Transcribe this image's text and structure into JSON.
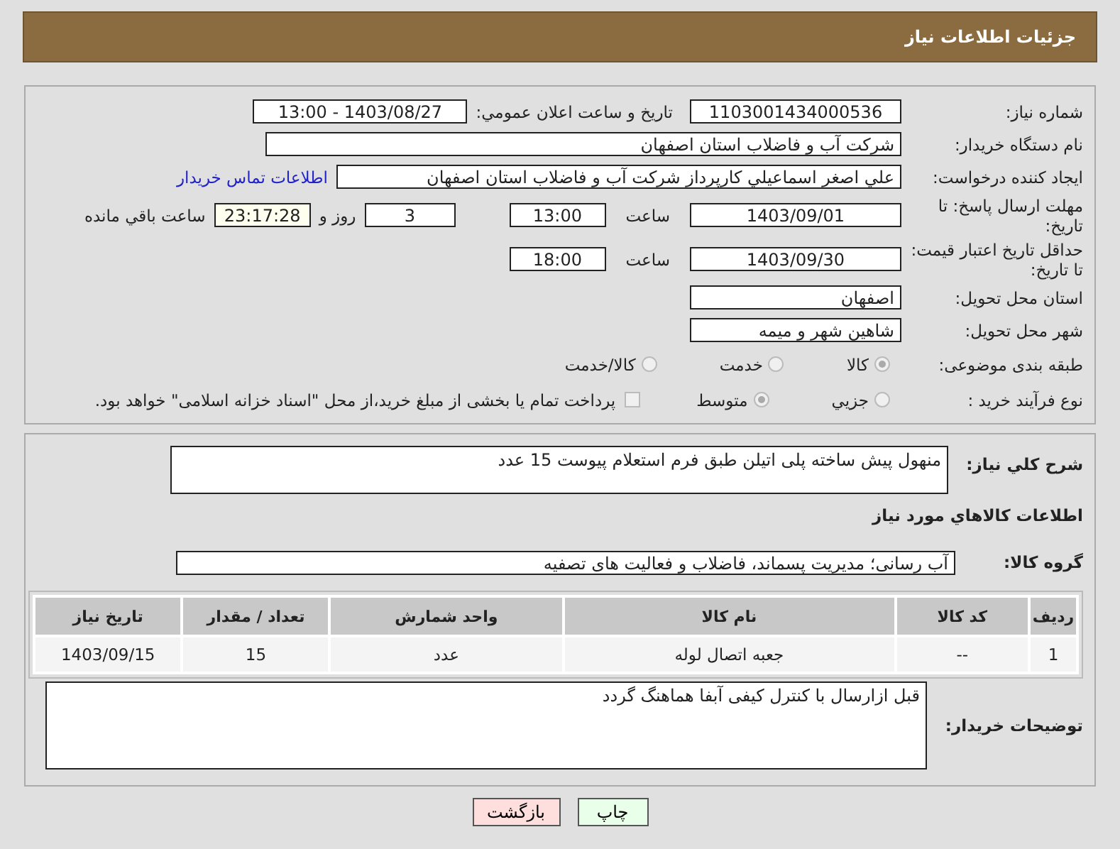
{
  "header": {
    "title": "جزئیات اطلاعات نیاز"
  },
  "need_number": {
    "label": "شماره نیاز:",
    "value": "1103001434000536"
  },
  "announce": {
    "label": "تاریخ و ساعت اعلان عمومي:",
    "value": "1403/08/27 - 13:00"
  },
  "buyer_org": {
    "label": "نام دستگاه خریدار:",
    "value": "شرکت آب و فاضلاب استان اصفهان"
  },
  "requester": {
    "label": "ایجاد کننده درخواست:",
    "value": "علي اصغر اسماعيلي کارپرداز شرکت آب و فاضلاب استان اصفهان",
    "link": "اطلاعات تماس خریدار"
  },
  "reply_deadline": {
    "label": "مهلت ارسال پاسخ: تا تاریخ:",
    "date": "1403/09/01",
    "time_label": "ساعت",
    "time": "13:00",
    "days": "3",
    "days_label": "روز و",
    "remaining": "23:17:28",
    "remaining_label": "ساعت باقي مانده"
  },
  "price_validity": {
    "label": "حداقل تاریخ اعتبار قیمت: تا تاریخ:",
    "date": "1403/09/30",
    "time_label": "ساعت",
    "time": "18:00"
  },
  "delivery_province": {
    "label": "استان محل تحویل:",
    "value": "اصفهان"
  },
  "delivery_city": {
    "label": "شهر محل تحویل:",
    "value": "شاهین شهر و میمه"
  },
  "category": {
    "label": "طبقه بندی موضوعی:",
    "options": [
      {
        "label": "کالا",
        "selected": true
      },
      {
        "label": "خدمت",
        "selected": false
      },
      {
        "label": "کالا/خدمت",
        "selected": false
      }
    ]
  },
  "purchase_type": {
    "label": "نوع فرآیند خرید :",
    "options": [
      {
        "label": "جزیي",
        "selected": false
      },
      {
        "label": "متوسط",
        "selected": true
      }
    ],
    "treasury": {
      "label": "پرداخت تمام یا بخشی از مبلغ خرید،از محل \"اسناد خزانه اسلامی\" خواهد بود.",
      "checked": false
    }
  },
  "description": {
    "label": "شرح كلي نياز:",
    "value": "منهول پیش ساخته پلی اتیلن طبق فرم استعلام پیوست 15 عدد"
  },
  "goods_heading": "اطلاعات كالاهاي مورد نياز",
  "goods_group": {
    "label": "گروه کالا:",
    "value": "آب رسانی؛ مدیریت پسماند، فاضلاب و فعالیت های تصفیه"
  },
  "table": {
    "columns": [
      "ردیف",
      "کد کالا",
      "نام کالا",
      "واحد شمارش",
      "تعداد / مقدار",
      "تاریخ نیاز"
    ],
    "rows": [
      [
        "1",
        "--",
        "جعبه اتصال لوله",
        "عدد",
        "15",
        "1403/09/15"
      ]
    ]
  },
  "buyer_notes": {
    "label": "توضیحات خریدار:",
    "value": "قبل ازارسال با کنترل کیفی آبفا هماهنگ گردد"
  },
  "buttons": [
    {
      "label": "چاپ",
      "kind": "print"
    },
    {
      "label": "بازگشت",
      "kind": "back"
    }
  ]
}
